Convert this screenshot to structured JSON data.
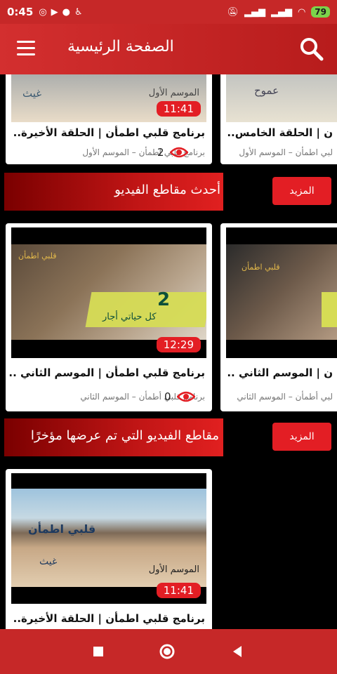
{
  "status_bar": {
    "time": "0:45",
    "battery": "79",
    "left_icons": [
      "notification-icon",
      "youtube-icon",
      "media-icon",
      "accessibility-icon"
    ],
    "right_icons": [
      "mute-icon",
      "signal-icon",
      "signal-icon",
      "wifi-icon"
    ]
  },
  "app_bar": {
    "title": "الصفحة الرئيسية"
  },
  "top_row": {
    "cards": [
      {
        "title": "برنامج قلبي اطمأن | الحلقة الأخيرة..",
        "subtitle": "برنامج قلبي اطمأن – الموسم الأول",
        "duration": "11:41",
        "views": "2",
        "thumb_text": "الموسم الأول",
        "thumb_logo": "غيث"
      },
      {
        "title": "ن | الحلقة الخامس..",
        "subtitle": "لبي اطمأن – الموسم الأول"
      }
    ]
  },
  "section_latest": {
    "title": "أحدث مقاطع الفيديو",
    "more_label": "المزيد",
    "cards": [
      {
        "title": "برنامج قلبي اطمأن | الموسم الثاني ..",
        "subtitle": "برنامج قلبي أطمأن – الموسم الثاني",
        "duration": "12:29",
        "views": "0",
        "thumb_number": "2",
        "thumb_caption": "كل حياتي أجار"
      },
      {
        "title": "ن | الموسم الثاني ..",
        "subtitle": "لبي أطمأن – الموسم الثاني"
      }
    ]
  },
  "section_recent": {
    "title": "مقاطع الفيديو التي تم عرضها مؤخرًا",
    "more_label": "المزيد",
    "cards": [
      {
        "title": "برنامج قلبي اطمأن | الحلقة الأخيرة..",
        "duration": "11:41",
        "thumb_text": "الموسم الأول",
        "thumb_logo": "غيث"
      }
    ]
  },
  "colors": {
    "primary": "#c62828",
    "accent": "#e31e24",
    "background": "#000000"
  },
  "nav_bar": {
    "icons": [
      "recent-apps-icon",
      "home-icon",
      "back-icon"
    ]
  }
}
